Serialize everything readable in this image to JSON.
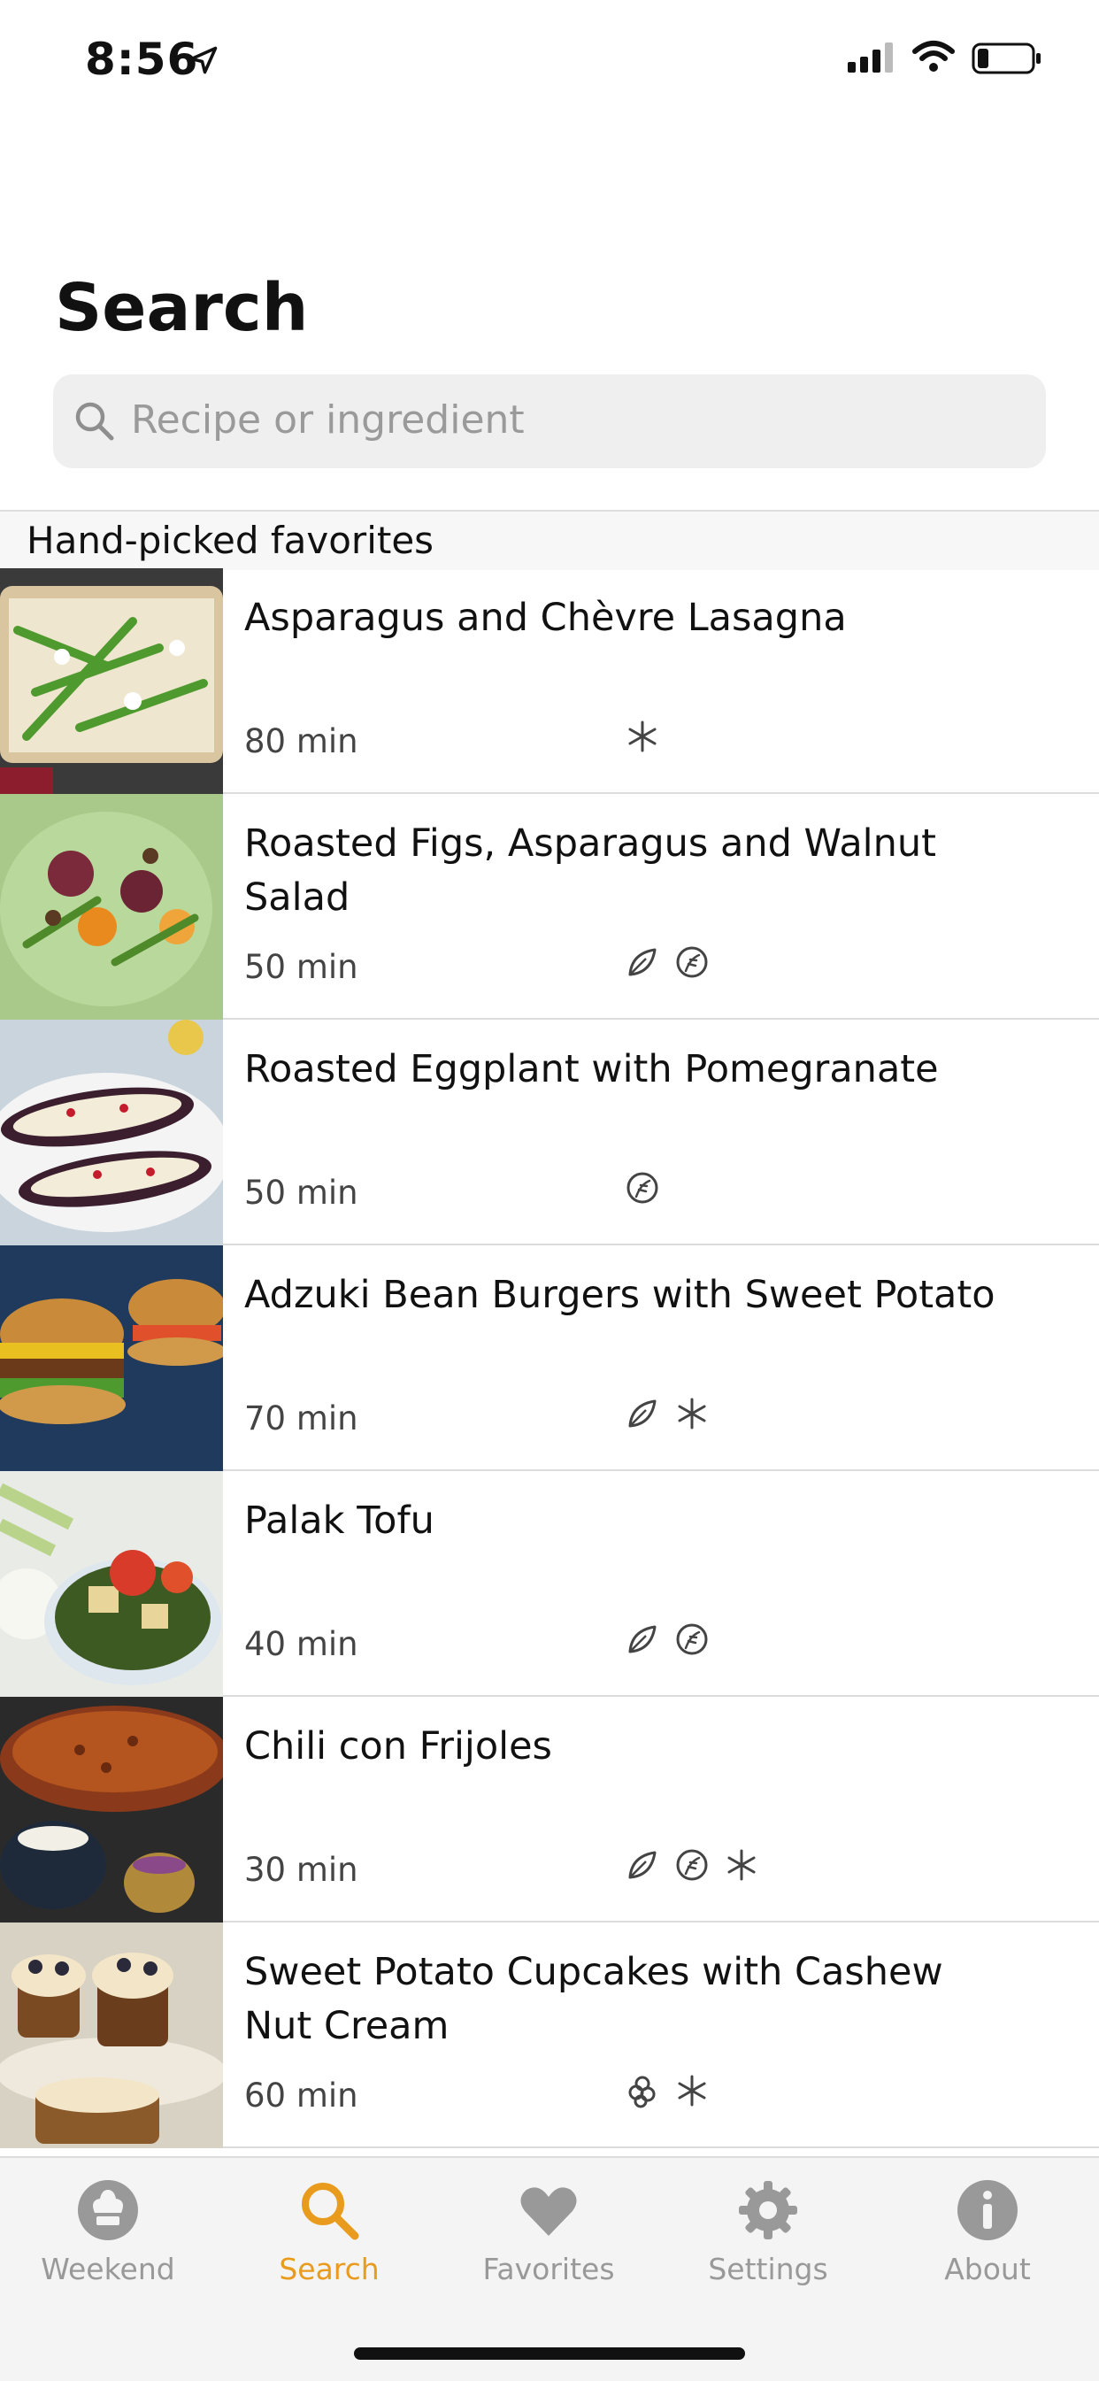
{
  "status_bar": {
    "time": "8:56"
  },
  "header": {
    "title": "Search"
  },
  "search": {
    "placeholder": "Recipe or ingredient"
  },
  "section": {
    "title": "Hand-picked favorites"
  },
  "recipes": [
    {
      "title": "Asparagus and Chèvre Lasagna",
      "time": "80 min",
      "badges": [
        "snowflake-icon"
      ]
    },
    {
      "title": "Roasted Figs, Asparagus and Walnut Salad",
      "time": "50 min",
      "badges": [
        "leaf-icon",
        "gluten-free-icon"
      ]
    },
    {
      "title": "Roasted Eggplant with Pomegranate",
      "time": "50 min",
      "badges": [
        "gluten-free-icon"
      ]
    },
    {
      "title": "Adzuki Bean Burgers with Sweet Potato",
      "time": "70 min",
      "badges": [
        "leaf-icon",
        "snowflake-icon"
      ]
    },
    {
      "title": "Palak Tofu",
      "time": "40 min",
      "badges": [
        "leaf-icon",
        "gluten-free-icon"
      ]
    },
    {
      "title": "Chili con Frijoles",
      "time": "30 min",
      "badges": [
        "leaf-icon",
        "gluten-free-icon",
        "snowflake-icon"
      ]
    },
    {
      "title": "Sweet Potato Cupcakes with Cashew Nut Cream",
      "time": "60 min",
      "badges": [
        "nut-icon",
        "snowflake-icon"
      ]
    }
  ],
  "tabs": [
    {
      "label": "Weekend",
      "icon": "chef-hat-icon",
      "active": false
    },
    {
      "label": "Search",
      "icon": "search-icon",
      "active": true
    },
    {
      "label": "Favorites",
      "icon": "heart-icon",
      "active": false
    },
    {
      "label": "Settings",
      "icon": "gear-icon",
      "active": false
    },
    {
      "label": "About",
      "icon": "info-icon",
      "active": false
    }
  ],
  "colors": {
    "accent": "#e99b1d",
    "inactive_tab": "#999999",
    "search_bg": "#efefef"
  }
}
